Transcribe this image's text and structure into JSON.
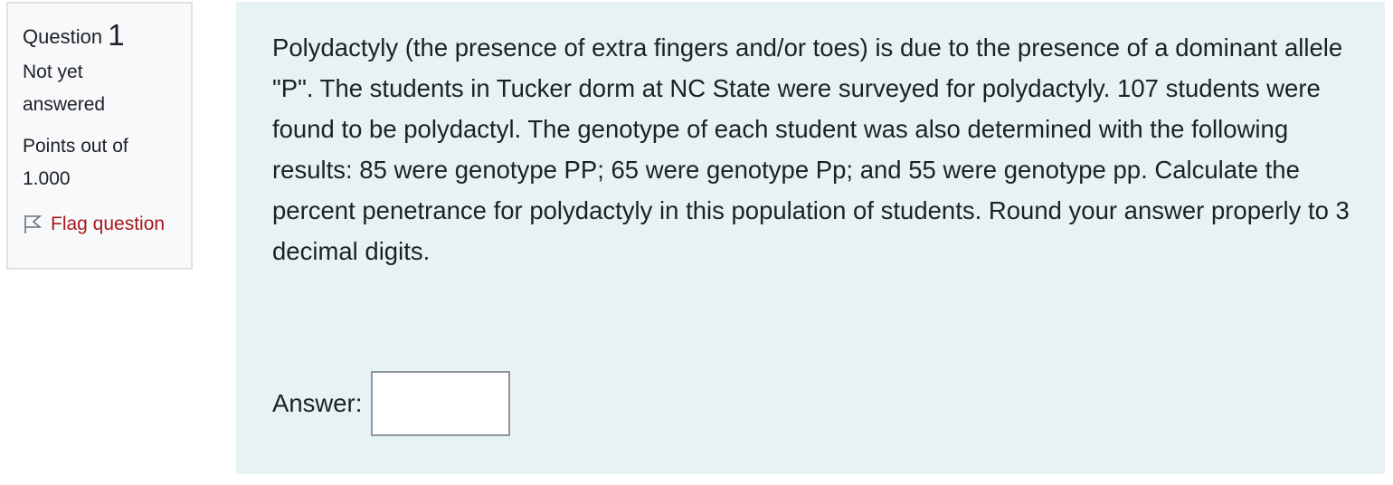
{
  "question_info": {
    "label": "Question",
    "number": "1",
    "state": "Not yet answered",
    "grade": "Points out of 1.000",
    "flag_label": "Flag question"
  },
  "question": {
    "text": "Polydactyly (the presence of extra fingers and/or toes) is due to the presence of a dominant allele \"P\". The students in Tucker dorm at NC State were surveyed for polydactyly. 107 students were found to be polydactyl. The genotype of each student was also determined with the following results: 85 were genotype PP; 65 were genotype Pp; and 55 were genotype pp. Calculate the percent penetrance for polydactyly in this population of students. Round your answer properly to 3 decimal digits.",
    "answer_label": "Answer:",
    "answer_value": ""
  },
  "colors": {
    "info_bg": "#f8f9fa",
    "content_bg": "#e7f2f4",
    "flag_color": "#a7191c"
  },
  "icons": {
    "flag": "flag-icon"
  }
}
